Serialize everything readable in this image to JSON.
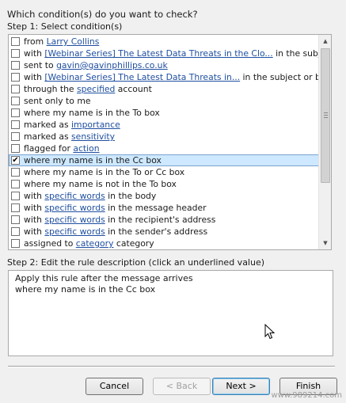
{
  "dialog": {
    "prompt": "Which condition(s) do you want to check?",
    "step1_label": "Step 1: Select condition(s)",
    "step2_label": "Step 2: Edit the rule description (click an underlined value)"
  },
  "conditions": [
    {
      "checked": false,
      "pre": "from ",
      "link": "Larry Collins",
      "post": ""
    },
    {
      "checked": false,
      "pre": "with ",
      "link": "[Webinar Series] The Latest Data Threats in the Clo...",
      "post": " in the subject"
    },
    {
      "checked": false,
      "pre": "sent to ",
      "link": "gavin@gavinphillips.co.uk",
      "post": ""
    },
    {
      "checked": false,
      "pre": "with ",
      "link": "[Webinar Series] The Latest Data Threats in...",
      "post": " in the subject or body"
    },
    {
      "checked": false,
      "pre": "through the ",
      "link": "specified",
      "post": " account"
    },
    {
      "checked": false,
      "pre": "sent only to me",
      "link": "",
      "post": ""
    },
    {
      "checked": false,
      "pre": "where my name is in the To box",
      "link": "",
      "post": ""
    },
    {
      "checked": false,
      "pre": "marked as ",
      "link": "importance",
      "post": ""
    },
    {
      "checked": false,
      "pre": "marked as ",
      "link": "sensitivity",
      "post": ""
    },
    {
      "checked": false,
      "pre": "flagged for ",
      "link": "action",
      "post": ""
    },
    {
      "checked": true,
      "selected": true,
      "pre": "where my name is in the Cc box",
      "link": "",
      "post": ""
    },
    {
      "checked": false,
      "pre": "where my name is in the To or Cc box",
      "link": "",
      "post": ""
    },
    {
      "checked": false,
      "pre": "where my name is not in the To box",
      "link": "",
      "post": ""
    },
    {
      "checked": false,
      "pre": "with ",
      "link": "specific words",
      "post": " in the body"
    },
    {
      "checked": false,
      "pre": "with ",
      "link": "specific words",
      "post": " in the message header"
    },
    {
      "checked": false,
      "pre": "with ",
      "link": "specific words",
      "post": " in the recipient's address"
    },
    {
      "checked": false,
      "pre": "with ",
      "link": "specific words",
      "post": " in the sender's address"
    },
    {
      "checked": false,
      "pre": "assigned to ",
      "link": "category",
      "post": " category"
    }
  ],
  "description": {
    "line1": "Apply this rule after the message arrives",
    "line2": "where my name is in the Cc box"
  },
  "buttons": {
    "cancel": "Cancel",
    "back": "< Back",
    "next": "Next >",
    "finish": "Finish"
  },
  "watermark": "www.989214.com",
  "icons": {
    "check": "checkmark-icon",
    "scroll_up": "scroll-up-arrow-icon",
    "scroll_down": "scroll-down-arrow-icon",
    "cursor": "mouse-pointer-icon"
  }
}
